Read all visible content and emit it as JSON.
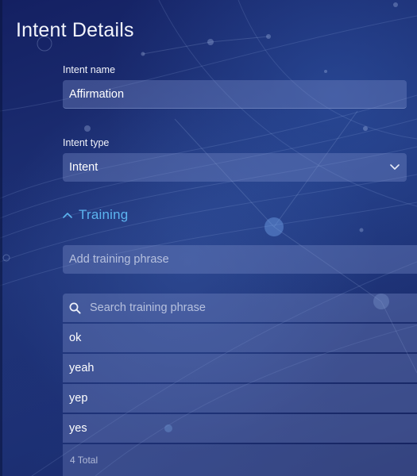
{
  "page": {
    "title": "Intent Details"
  },
  "intent_name": {
    "label": "Intent name",
    "value": "Affirmation"
  },
  "intent_type": {
    "label": "Intent type",
    "value": "Intent"
  },
  "training": {
    "section_title": "Training",
    "expanded": true,
    "add_placeholder": "Add training phrase",
    "search_placeholder": "Search training phrase",
    "phrases": [
      "ok",
      "yeah",
      "yep",
      "yes"
    ],
    "total_text": "4 Total"
  },
  "colors": {
    "accent": "#5cb4f0",
    "background": "#1b2a6b"
  },
  "icons": {
    "type_dropdown": "chevron-down-icon",
    "training_toggle": "chevron-up-icon",
    "search": "search-icon"
  }
}
